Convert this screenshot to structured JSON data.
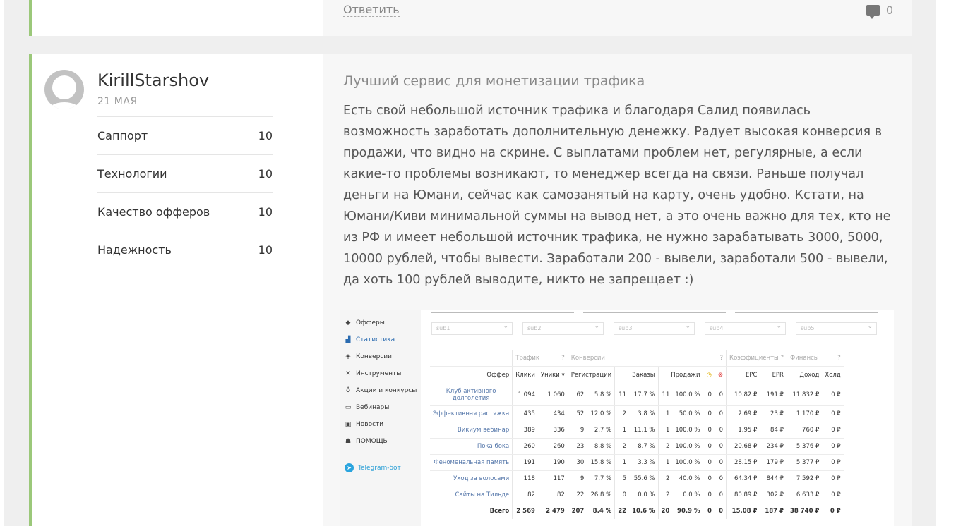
{
  "prev_comment": {
    "reply_label": "Ответить",
    "comments_count": "0"
  },
  "review": {
    "author": "KirillStarshov",
    "date": "21 МАЯ",
    "ratings": [
      {
        "label": "Саппорт",
        "value": "10"
      },
      {
        "label": "Технологии",
        "value": "10"
      },
      {
        "label": "Качество офферов",
        "value": "10"
      },
      {
        "label": "Надежность",
        "value": "10"
      }
    ],
    "title": "Лучший сервис для монетизации трафика",
    "text": "Есть свой небольшой источник трафика и благодаря Салид появилась возможность заработать дополнительную денежку. Радует высокая конверсия в продажи, что видно на скрине. С выплатами проблем нет, регулярные, а если какие-то проблемы возникают, то менеджер всегда на связи. Раньше получал деньги на Юмани, сейчас как самозанятый на карту, очень удобно. Кстати, на Юмани/Киви минимальной суммы на вывод нет, а это очень важно для тех, кто не из РФ и имеет небольшой источник трафика, не нужно зарабатывать 3000, 5000, 10000 рублей, чтобы вывести. Заработали 200 - вывели, заработали 500 - вывели, да хоть 100 рублей выводите, никто не запрещает :)"
  },
  "screenshot": {
    "menu": [
      {
        "label": "Офферы",
        "icon": "tag-icon",
        "glyph": "◆"
      },
      {
        "label": "Статистика",
        "icon": "chart-icon",
        "glyph": "▟"
      },
      {
        "label": "Конверсии",
        "icon": "target-icon",
        "glyph": "◈"
      },
      {
        "label": "Инструменты",
        "icon": "tools-icon",
        "glyph": "✕"
      },
      {
        "label": "Акции и конкурсы",
        "icon": "medal-icon",
        "glyph": "♁"
      },
      {
        "label": "Вебинары",
        "icon": "monitor-icon",
        "glyph": "▭"
      },
      {
        "label": "Новости",
        "icon": "news-icon",
        "glyph": "▣"
      },
      {
        "label": "ПОМОЩЬ",
        "icon": "support-icon",
        "glyph": "☗"
      }
    ],
    "telegram": {
      "label": "Telegram-бот",
      "glyph": "➤"
    },
    "subs": [
      "sub1",
      "sub2",
      "sub3",
      "sub4",
      "sub5"
    ],
    "groups": {
      "traffic": "Трафик",
      "conversions": "Конверсии",
      "coefficients": "Коэффициенты",
      "finance": "Финансы",
      "q": "?"
    },
    "headers": {
      "offer": "Оффер",
      "clicks": "Клики",
      "uniques": "Уники ▾",
      "registrations": "Регистрации",
      "orders": "Заказы",
      "sales": "Продажи",
      "pending": "◷",
      "rejected": "⊗",
      "epc": "EPC",
      "epr": "EPR",
      "income": "Доход",
      "hold": "Холд"
    },
    "rows": [
      {
        "offer": "Клуб активного долголетия",
        "clicks": "1 094",
        "uniques": "1 060",
        "reg": "62",
        "reg_pct": "5.8 %",
        "orders": "11",
        "orders_pct": "17.7 %",
        "sales": "11",
        "sales_pct": "100.0 %",
        "pending": "0",
        "rejected": "0",
        "epc": "10.82 ₽",
        "epr": "191 ₽",
        "income": "11 832 ₽",
        "hold": "0 ₽"
      },
      {
        "offer": "Эффективная растяжка",
        "clicks": "435",
        "uniques": "434",
        "reg": "52",
        "reg_pct": "12.0 %",
        "orders": "2",
        "orders_pct": "3.8 %",
        "sales": "1",
        "sales_pct": "50.0 %",
        "pending": "0",
        "rejected": "0",
        "epc": "2.69 ₽",
        "epr": "23 ₽",
        "income": "1 170 ₽",
        "hold": "0 ₽"
      },
      {
        "offer": "Викиум вебинар",
        "clicks": "389",
        "uniques": "336",
        "reg": "9",
        "reg_pct": "2.7 %",
        "orders": "1",
        "orders_pct": "11.1 %",
        "sales": "1",
        "sales_pct": "100.0 %",
        "pending": "0",
        "rejected": "0",
        "epc": "1.95 ₽",
        "epr": "84 ₽",
        "income": "760 ₽",
        "hold": "0 ₽"
      },
      {
        "offer": "Пока бока",
        "clicks": "260",
        "uniques": "260",
        "reg": "23",
        "reg_pct": "8.8 %",
        "orders": "2",
        "orders_pct": "8.7 %",
        "sales": "2",
        "sales_pct": "100.0 %",
        "pending": "0",
        "rejected": "0",
        "epc": "20.68 ₽",
        "epr": "234 ₽",
        "income": "5 376 ₽",
        "hold": "0 ₽"
      },
      {
        "offer": "Феноменальная память",
        "clicks": "191",
        "uniques": "190",
        "reg": "30",
        "reg_pct": "15.8 %",
        "orders": "1",
        "orders_pct": "3.3 %",
        "sales": "1",
        "sales_pct": "100.0 %",
        "pending": "0",
        "rejected": "0",
        "epc": "28.15 ₽",
        "epr": "179 ₽",
        "income": "5 377 ₽",
        "hold": "0 ₽"
      },
      {
        "offer": "Уход за волосами",
        "clicks": "118",
        "uniques": "117",
        "reg": "9",
        "reg_pct": "7.7 %",
        "orders": "5",
        "orders_pct": "55.6 %",
        "sales": "2",
        "sales_pct": "40.0 %",
        "pending": "0",
        "rejected": "0",
        "epc": "64.34 ₽",
        "epr": "844 ₽",
        "income": "7 592 ₽",
        "hold": "0 ₽"
      },
      {
        "offer": "Сайты на Тильде",
        "clicks": "82",
        "uniques": "82",
        "reg": "22",
        "reg_pct": "26.8 %",
        "orders": "0",
        "orders_pct": "0.0 %",
        "sales": "2",
        "sales_pct": "0.0 %",
        "pending": "0",
        "rejected": "0",
        "epc": "80.89 ₽",
        "epr": "302 ₽",
        "income": "6 633 ₽",
        "hold": "0 ₽"
      }
    ],
    "total": {
      "offer": "Всего",
      "clicks": "2 569",
      "uniques": "2 479",
      "reg": "207",
      "reg_pct": "8.4 %",
      "orders": "22",
      "orders_pct": "10.6 %",
      "sales": "20",
      "sales_pct": "90.9 %",
      "pending": "0",
      "rejected": "0",
      "epc": "15.08 ₽",
      "epr": "187 ₽",
      "income": "38 740 ₽",
      "hold": "0 ₽"
    }
  },
  "colors": {
    "accent": "#9bc87a",
    "link": "#5577aa",
    "telegram": "#2aa4de"
  }
}
